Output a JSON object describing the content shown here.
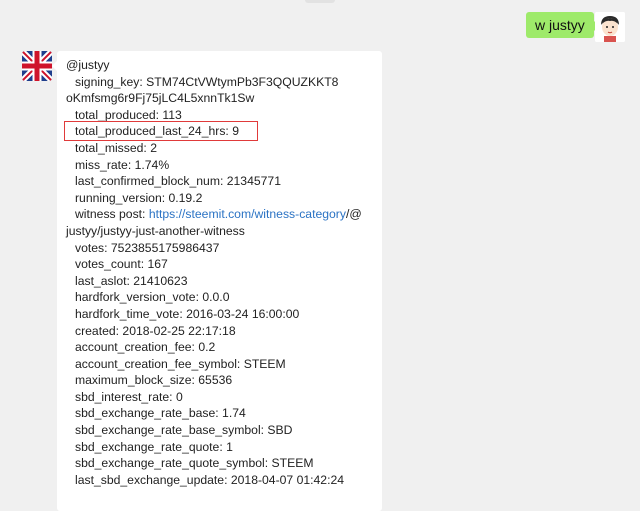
{
  "chat": {
    "outgoing": {
      "text": "w justyy"
    },
    "incoming": {
      "lines": [
        {
          "text": "@justyy"
        },
        {
          "text": "signing_key: STM74CtVWtymPb3F3QQUZKKT8"
        },
        {
          "text": "oKmfsmg6r9Fj75jLC4L5xnnTk1Sw"
        },
        {
          "text": "total_produced: 113"
        },
        {
          "text": "total_produced_last_24_hrs: 9"
        },
        {
          "text": "total_missed: 2"
        },
        {
          "text": "miss_rate: 1.74%"
        },
        {
          "text": "last_confirmed_block_num: 21345771"
        },
        {
          "text": "running_version: 0.19.2"
        },
        {
          "text": "witness post: ",
          "link": "https://steemit.com/witness-category",
          "after": "/@"
        },
        {
          "text": "justyy/justyy-just-another-witness"
        },
        {
          "text": "votes: 7523855175986437"
        },
        {
          "text": "votes_count: 167"
        },
        {
          "text": "last_aslot: 21410623"
        },
        {
          "text": "hardfork_version_vote: 0.0.0"
        },
        {
          "text": "hardfork_time_vote: 2016-03-24 16:00:00"
        },
        {
          "text": "created: 2018-02-25 22:17:18"
        },
        {
          "text": "account_creation_fee: 0.2"
        },
        {
          "text": "account_creation_fee_symbol: STEEM"
        },
        {
          "text": "maximum_block_size: 65536"
        },
        {
          "text": "sbd_interest_rate: 0"
        },
        {
          "text": "sbd_exchange_rate_base: 1.74"
        },
        {
          "text": "sbd_exchange_rate_base_symbol: SBD"
        },
        {
          "text": "sbd_exchange_rate_quote: 1"
        },
        {
          "text": "sbd_exchange_rate_quote_symbol: STEEM"
        },
        {
          "text": "last_sbd_exchange_update: 2018-04-07 01:42:24"
        }
      ]
    }
  },
  "colors": {
    "background": "#f0f0f0",
    "outgoing_bubble": "#9eea6a",
    "incoming_bubble": "#ffffff",
    "link": "#2b73c4",
    "highlight_border": "#e03a3a"
  },
  "icons": {
    "user_avatar": "cartoon-face-avatar",
    "bot_avatar": "union-jack-flag-avatar"
  }
}
